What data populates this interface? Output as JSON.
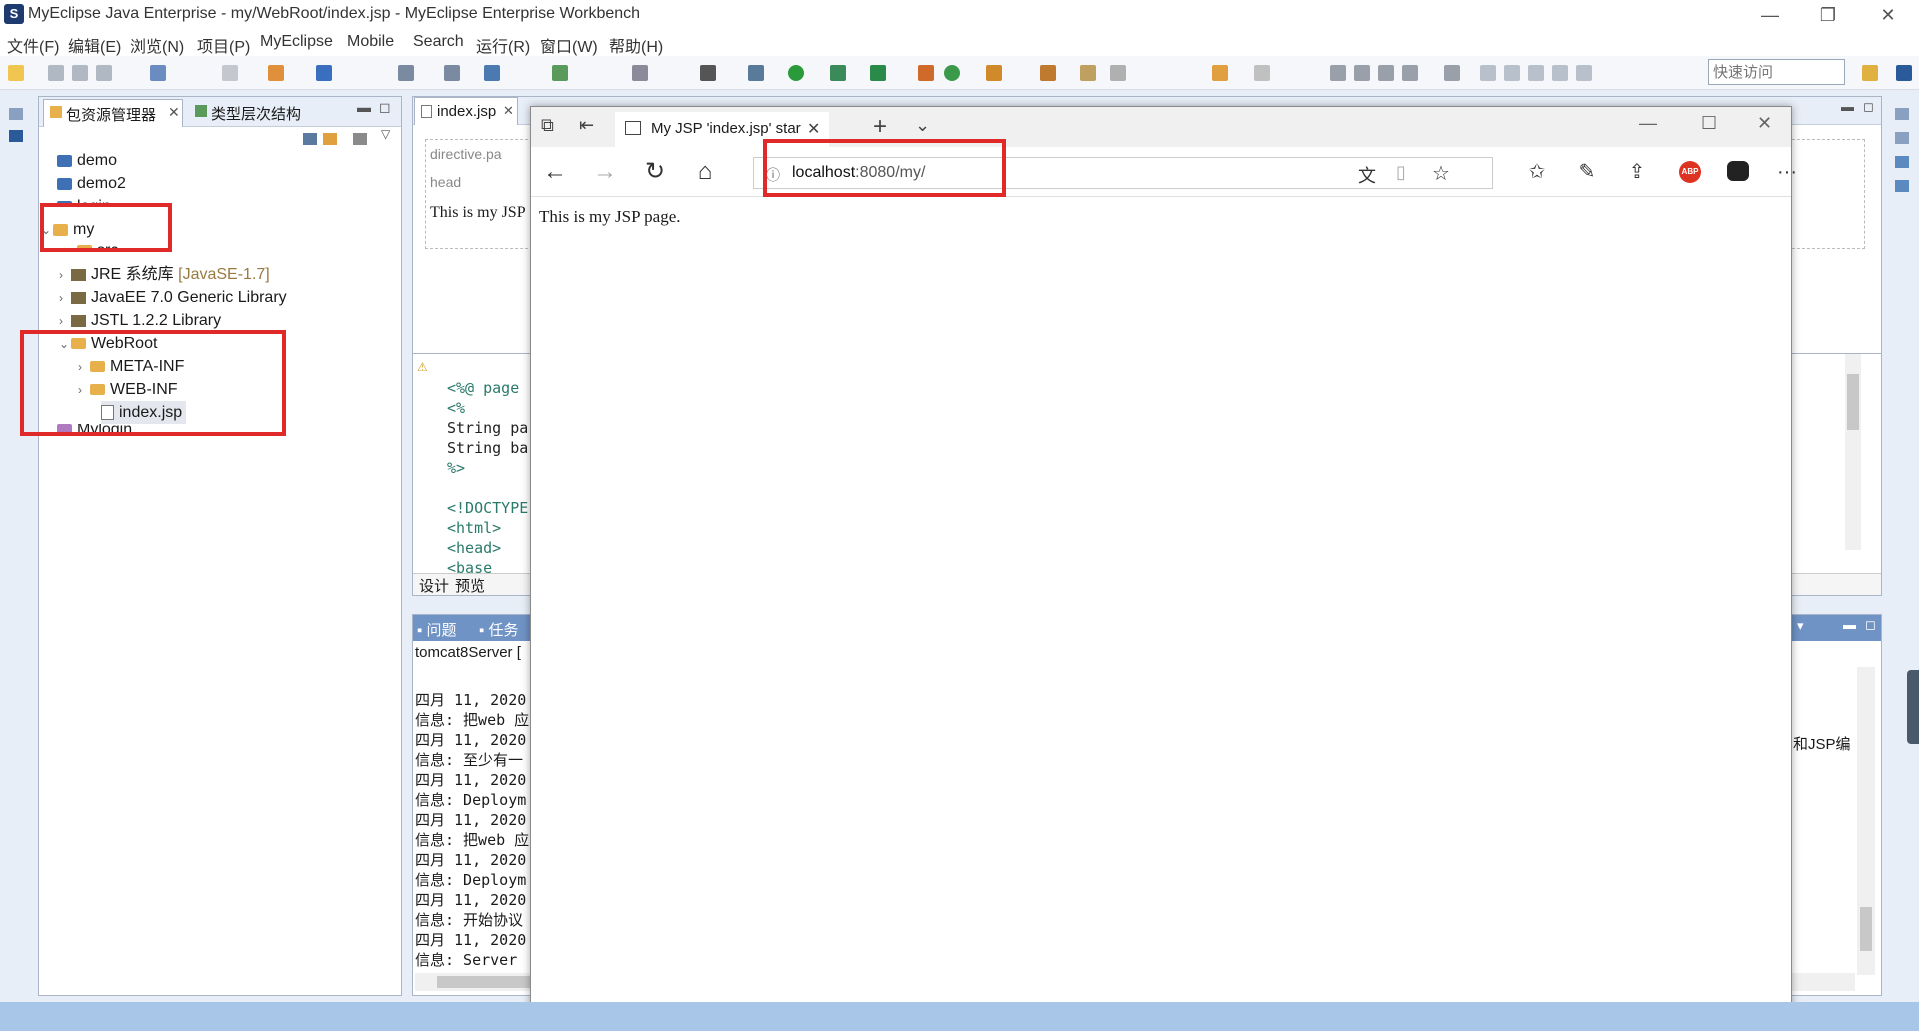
{
  "window": {
    "title": "MyEclipse Java Enterprise - my/WebRoot/index.jsp - MyEclipse Enterprise Workbench",
    "logo_text": "S"
  },
  "menu": [
    "文件(F)",
    "编辑(E)",
    "浏览(N)",
    "项目(P)",
    "MyEclipse",
    "Mobile",
    "Search",
    "运行(R)",
    "窗口(W)",
    "帮助(H)"
  ],
  "quick_access": {
    "placeholder": "快速访问"
  },
  "package_explorer": {
    "tab_active": "包资源管理器",
    "tab_other": "类型层次结构",
    "items": [
      {
        "label": "demo"
      },
      {
        "label": "demo2"
      },
      {
        "label": "login"
      },
      {
        "label": "my"
      },
      {
        "label": "src"
      },
      {
        "label": "JRE 系统库",
        "suffix": "[JavaSE-1.7]"
      },
      {
        "label": "JavaEE 7.0 Generic Library"
      },
      {
        "label": "JSTL 1.2.2 Library"
      },
      {
        "label": "WebRoot"
      },
      {
        "label": "META-INF"
      },
      {
        "label": "WEB-INF"
      },
      {
        "label": "index.jsp"
      },
      {
        "label": "Mylogin"
      }
    ]
  },
  "editor": {
    "tab": "index.jsp",
    "design_labels": [
      "directive.pa",
      "head"
    ],
    "preview_text": "This is my JSP",
    "code_lines": [
      "<%@ page",
      "<%",
      "String pa",
      "String ba",
      "%>",
      "",
      "<!DOCTYPE",
      "<html>",
      "<head>",
      "<base"
    ],
    "bottom_tabs": [
      "设计",
      "预览"
    ]
  },
  "bottom_panel": {
    "tabs": [
      "问题",
      "任务"
    ],
    "server": "tomcat8Server [",
    "clipped_right": "和JSP编",
    "log_lines": [
      "四月 11, 2020",
      "信息: 把web 应",
      "四月 11, 2020",
      "信息: 至少有一",
      "四月 11, 2020",
      "信息: Deploym",
      "四月 11, 2020",
      "信息: 把web 应",
      "四月 11, 2020",
      "信息: Deploym",
      "四月 11, 2020",
      "信息: 开始协议",
      "四月 11, 2020",
      "信息: Server"
    ]
  },
  "browser": {
    "tab_title": "My JSP 'index.jsp' startir",
    "url_host": "localhost",
    "url_rest": ":8080/my/",
    "page_text": "This is my JSP page."
  },
  "colors": {
    "highlight_box": "#e02a2a",
    "ide_background": "#e8eef7",
    "status_bar": "#a7c6e8"
  }
}
